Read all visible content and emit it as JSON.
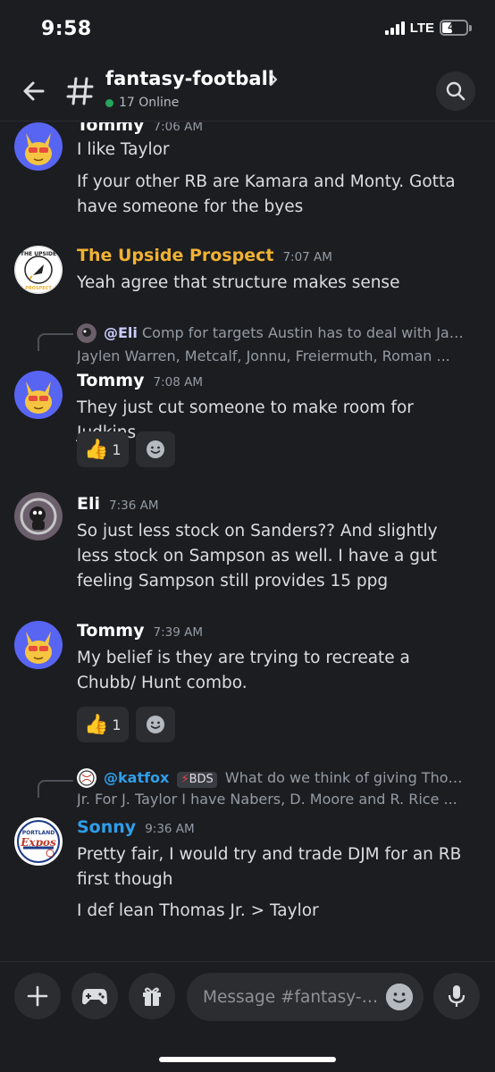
{
  "status_bar": {
    "time": "9:58",
    "network": "LTE",
    "battery": "44"
  },
  "header": {
    "channel": "fantasy-football",
    "online": "17 Online"
  },
  "messages": [
    {
      "author": "Tommy",
      "time": "7:06 AM",
      "color": "#ffffff",
      "lines": [
        "I like Taylor",
        "If your other RB are Kamara and Monty. Gotta have someone for the byes"
      ]
    },
    {
      "author": "The Upside Prospect",
      "time": "7:07 AM",
      "color": "#f0b232",
      "lines": [
        "Yeah agree that structure makes sense"
      ]
    },
    {
      "reply": {
        "mention": "@Eli",
        "text": "Comp for targets  Austin has to deal with Jaylen Warren, Metcalf, Jonnu, Freiermuth, Roman ..."
      },
      "author": "Tommy",
      "time": "7:08 AM",
      "color": "#ffffff",
      "lines": [
        "They just cut someone to make room for Judkins"
      ],
      "reaction": {
        "emoji": "thumbs-up",
        "count": "1"
      }
    },
    {
      "author": "Eli",
      "time": "7:36 AM",
      "color": "#ffffff",
      "lines": [
        "So just less stock on Sanders?? And slightly less stock on Sampson as well. I have a gut feeling Sampson still provides 15 ppg"
      ]
    },
    {
      "author": "Tommy",
      "time": "7:39 AM",
      "color": "#ffffff",
      "lines": [
        "My belief is they are trying to recreate a Chubb/ Hunt combo."
      ],
      "reaction": {
        "emoji": "thumbs-up",
        "count": "1"
      }
    },
    {
      "reply": {
        "mention": "@katfox",
        "tag": "BDS",
        "text": "What do we think of giving Thomas Jr. For  J. Taylor  I have Nabers, D. Moore and R. Rice ..."
      },
      "author": "Sonny",
      "time": "9:36 AM",
      "color": "#2f9ee8",
      "lines": [
        "Pretty fair, I would try and trade DJM for an RB first though",
        "I def lean Thomas Jr. > Taylor"
      ]
    }
  ],
  "composer": {
    "placeholder": "Message #fantasy-f..."
  }
}
